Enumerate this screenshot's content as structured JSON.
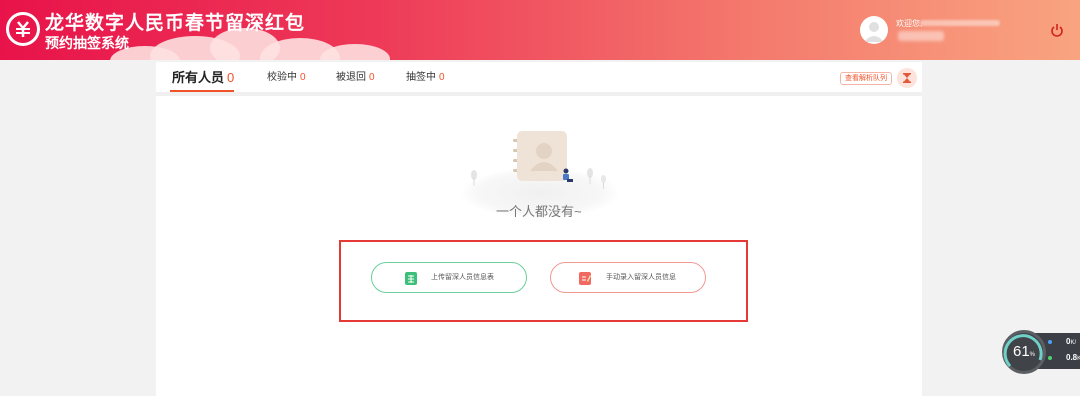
{
  "header": {
    "title_line1": "龙华数字人民币春节留深红包",
    "title_line2": "预约抽签系统",
    "welcome": "欢迎您,",
    "colors": {
      "start": "#e8134a",
      "end": "#f9a480"
    }
  },
  "tabs": [
    {
      "label": "所有人员",
      "count": "0",
      "active": true
    },
    {
      "label": "校验中",
      "count": "0"
    },
    {
      "label": "被退回",
      "count": "0"
    },
    {
      "label": "抽签中",
      "count": "0"
    }
  ],
  "toolbar": {
    "queue_label": "查看解析队列"
  },
  "empty_state": {
    "text": "一个人都没有~"
  },
  "actions": {
    "upload_label": "上传留深人员信息表",
    "manual_label": "手动录入留深人员信息"
  },
  "widget": {
    "cpu_percent": "61",
    "cpu_unit": "%",
    "upload_speed": "0",
    "download_speed": "0.8",
    "speed_unit_partial": "K/"
  },
  "colors": {
    "accent": "#f0522a",
    "upload_green": "#3cbf7a",
    "manual_red": "#f06a62",
    "highlight_red": "#e53935"
  }
}
